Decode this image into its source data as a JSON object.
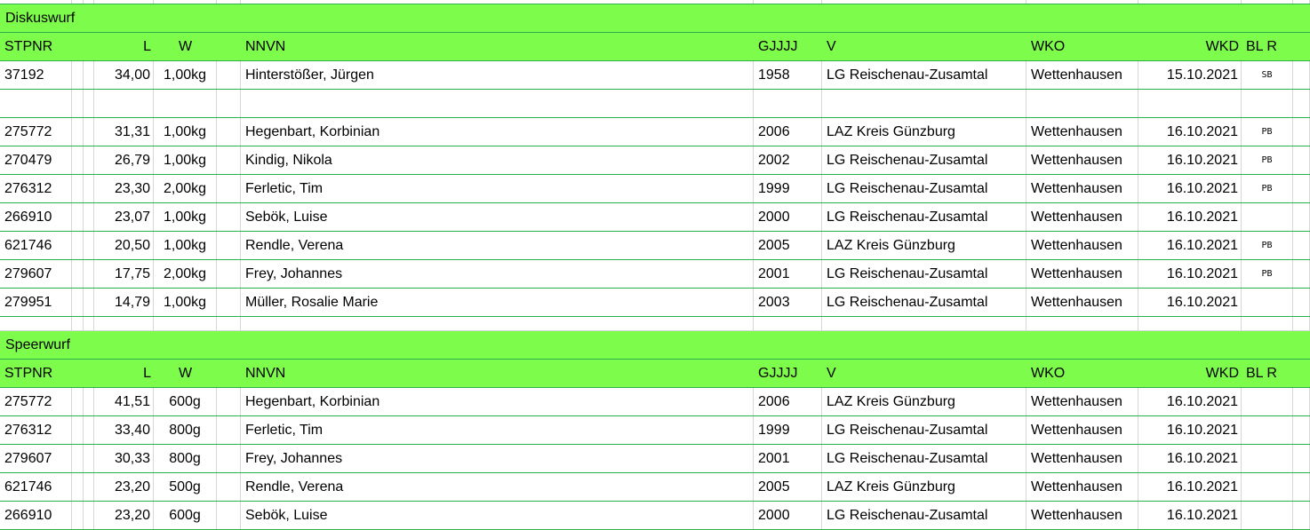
{
  "headers": {
    "stpnr": "STPNR",
    "l": "L",
    "w": "W",
    "nnvn": "NNVN",
    "gjjjj": "GJJJJ",
    "v": "V",
    "wko": "WKO",
    "wkd": "WKD",
    "blr": "BL R"
  },
  "sections": [
    {
      "title": "Diskuswurf",
      "rows": [
        {
          "stpnr": "37192",
          "l": "34,00",
          "w": "1,00kg",
          "name": "Hinterstößer, Jürgen",
          "year": "1958",
          "club": "LG Reischenau-Zusamtal",
          "wko": "Wettenhausen",
          "wkd": "15.10.2021",
          "mark": "SB"
        },
        null,
        {
          "stpnr": "275772",
          "l": "31,31",
          "w": "1,00kg",
          "name": "Hegenbart, Korbinian",
          "year": "2006",
          "club": "LAZ Kreis Günzburg",
          "wko": "Wettenhausen",
          "wkd": "16.10.2021",
          "mark": "PB"
        },
        {
          "stpnr": "270479",
          "l": "26,79",
          "w": "1,00kg",
          "name": "Kindig, Nikola",
          "year": "2002",
          "club": "LG Reischenau-Zusamtal",
          "wko": "Wettenhausen",
          "wkd": "16.10.2021",
          "mark": "PB"
        },
        {
          "stpnr": "276312",
          "l": "23,30",
          "w": "2,00kg",
          "name": "Ferletic, Tim",
          "year": "1999",
          "club": "LG Reischenau-Zusamtal",
          "wko": "Wettenhausen",
          "wkd": "16.10.2021",
          "mark": "PB"
        },
        {
          "stpnr": "266910",
          "l": "23,07",
          "w": "1,00kg",
          "name": "Sebök, Luise",
          "year": "2000",
          "club": "LG Reischenau-Zusamtal",
          "wko": "Wettenhausen",
          "wkd": "16.10.2021",
          "mark": ""
        },
        {
          "stpnr": "621746",
          "l": "20,50",
          "w": "1,00kg",
          "name": "Rendle, Verena",
          "year": "2005",
          "club": "LAZ Kreis Günzburg",
          "wko": "Wettenhausen",
          "wkd": "16.10.2021",
          "mark": "PB"
        },
        {
          "stpnr": "279607",
          "l": "17,75",
          "w": "2,00kg",
          "name": "Frey, Johannes",
          "year": "2001",
          "club": "LG Reischenau-Zusamtal",
          "wko": "Wettenhausen",
          "wkd": "16.10.2021",
          "mark": "PB"
        },
        {
          "stpnr": "279951",
          "l": "14,79",
          "w": "1,00kg",
          "name": "Müller, Rosalie Marie",
          "year": "2003",
          "club": "LG Reischenau-Zusamtal",
          "wko": "Wettenhausen",
          "wkd": "16.10.2021",
          "mark": ""
        }
      ]
    },
    {
      "title": "Speerwurf",
      "rows": [
        {
          "stpnr": "275772",
          "l": "41,51",
          "w": "600g",
          "name": "Hegenbart, Korbinian",
          "year": "2006",
          "club": "LAZ Kreis Günzburg",
          "wko": "Wettenhausen",
          "wkd": "16.10.2021",
          "mark": ""
        },
        {
          "stpnr": "276312",
          "l": "33,40",
          "w": "800g",
          "name": "Ferletic, Tim",
          "year": "1999",
          "club": "LG Reischenau-Zusamtal",
          "wko": "Wettenhausen",
          "wkd": "16.10.2021",
          "mark": ""
        },
        {
          "stpnr": "279607",
          "l": "30,33",
          "w": "800g",
          "name": "Frey, Johannes",
          "year": "2001",
          "club": "LG Reischenau-Zusamtal",
          "wko": "Wettenhausen",
          "wkd": "16.10.2021",
          "mark": ""
        },
        {
          "stpnr": "621746",
          "l": "23,20",
          "w": "500g",
          "name": "Rendle, Verena",
          "year": "2005",
          "club": "LAZ Kreis Günzburg",
          "wko": "Wettenhausen",
          "wkd": "16.10.2021",
          "mark": ""
        },
        {
          "stpnr": "266910",
          "l": "23,20",
          "w": "600g",
          "name": "Sebök, Luise",
          "year": "2000",
          "club": "LG Reischenau-Zusamtal",
          "wko": "Wettenhausen",
          "wkd": "16.10.2021",
          "mark": ""
        }
      ]
    }
  ]
}
